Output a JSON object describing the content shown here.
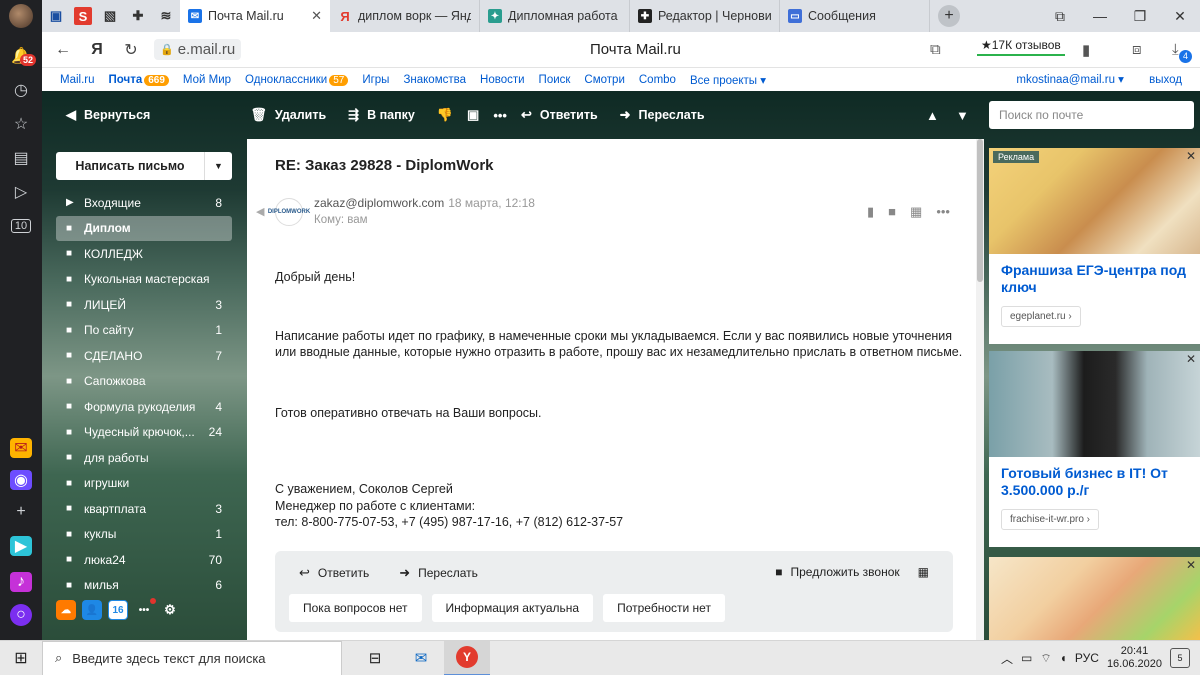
{
  "browser_sidebar": {
    "badge": "52",
    "tab_counter": "10"
  },
  "tabs": {
    "pinned_s": "S",
    "items": [
      {
        "label": "Почта Mail.ru",
        "active": true
      },
      {
        "label": "диплом ворк — Янде"
      },
      {
        "label": "Дипломная работа н"
      },
      {
        "label": "Редактор | Черновик"
      },
      {
        "label": "Сообщения"
      }
    ]
  },
  "address": {
    "url": "e.mail.ru",
    "page_title": "Почта Mail.ru",
    "reviews": "★17К отзывов",
    "downloads": "4"
  },
  "portal": {
    "links": [
      {
        "label": "Mail.ru"
      },
      {
        "label": "Почта",
        "count": "669",
        "bold": true
      },
      {
        "label": "Мой Мир"
      },
      {
        "label": "Одноклассники",
        "count": "57"
      },
      {
        "label": "Игры"
      },
      {
        "label": "Знакомства"
      },
      {
        "label": "Новости"
      },
      {
        "label": "Поиск"
      },
      {
        "label": "Смотри"
      },
      {
        "label": "Combo"
      },
      {
        "label": "Все проекты ▾"
      }
    ],
    "user": "mkostinaa@mail.ru ▾",
    "logout": "выход"
  },
  "toolbar": {
    "back": "Вернуться",
    "delete": "Удалить",
    "to_folder": "В папку",
    "reply": "Ответить",
    "forward": "Переслать",
    "search_placeholder": "Поиск по почте"
  },
  "compose": "Написать письмо",
  "folders": [
    {
      "name": "Входящие",
      "count": "8",
      "icon": "▶"
    },
    {
      "name": "Диплом",
      "count": "",
      "active": true
    },
    {
      "name": "КОЛЛЕДЖ",
      "count": ""
    },
    {
      "name": "Кукольная мастерская",
      "count": ""
    },
    {
      "name": "ЛИЦЕЙ",
      "count": "3"
    },
    {
      "name": "По сайту",
      "count": "1"
    },
    {
      "name": "СДЕЛАНО",
      "count": "7"
    },
    {
      "name": "Сапожкова",
      "count": ""
    },
    {
      "name": "Формула рукоделия",
      "count": "4"
    },
    {
      "name": "Чудесный крючок,...",
      "count": "24"
    },
    {
      "name": "для работы",
      "count": ""
    },
    {
      "name": "игрушки",
      "count": ""
    },
    {
      "name": "квартплата",
      "count": "3"
    },
    {
      "name": "куклы",
      "count": "1"
    },
    {
      "name": "люка24",
      "count": "70"
    },
    {
      "name": "милья",
      "count": "6"
    }
  ],
  "bottom_icons": {
    "calendar_day": "16"
  },
  "message": {
    "subject": "RE: Заказ 29828 - DiplomWork",
    "avatar_text": "DIPLOMWORK",
    "from": "zakaz@diplomwork.com",
    "date": "18 марта, 12:18",
    "to": "Кому: вам",
    "greeting": "Добрый день!",
    "para1": "Написание работы идет по графику, в намеченные сроки мы укладываемся. Если у вас появились новые уточнения или вводные данные, которые нужно отразить в работе, прошу вас их незамедлительно прислать в ответном письме.",
    "para2": "Готов оперативно отвечать на Ваши вопросы.",
    "sig1": "С уважением, Соколов Сергей",
    "sig2": "Менеджер по работе с клиентами:",
    "sig3": "тел:  8-800-775-07-53, +7 (495) 987-17-16, +7 (812) 612-37-57"
  },
  "replybox": {
    "reply": "Ответить",
    "forward": "Переслать",
    "call": "Предложить звонок",
    "quick": [
      "Пока вопросов нет",
      "Информация актуальна",
      "Потребности нет"
    ]
  },
  "ads": [
    {
      "tag": "Реклама",
      "title": "Франшиза ЕГЭ-центра под ключ",
      "source": "egeplanet.ru ›"
    },
    {
      "title": "Готовый бизнес в IT! От 3.500.000 р./г",
      "source": "frachise-it-wr.pro ›"
    }
  ],
  "taskbar": {
    "search_placeholder": "Введите здесь текст для поиска",
    "lang": "РУС",
    "time": "20:41",
    "date": "16.06.2020",
    "notifications": "5"
  },
  "colors": {
    "accent_link": "#005bd1",
    "counter": "#ff9e00",
    "badge_red": "#e2342d"
  }
}
